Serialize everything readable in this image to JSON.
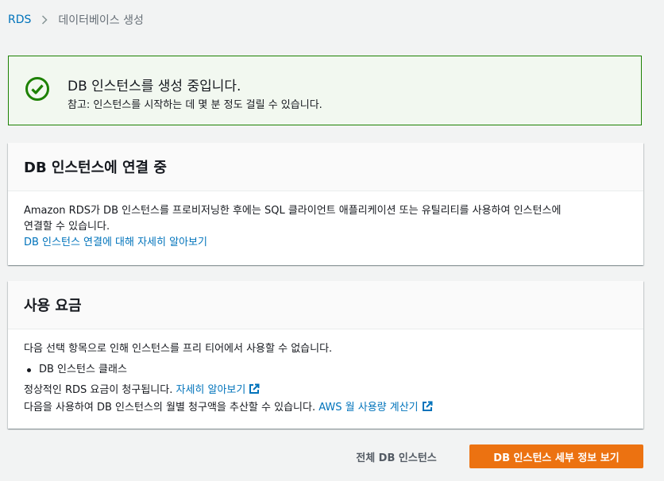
{
  "breadcrumb": {
    "root": "RDS",
    "current": "데이터베이스 생성"
  },
  "flash": {
    "title": "DB 인스턴스를 생성 중입니다.",
    "subtitle": "참고: 인스턴스를 시작하는 데 몇 분 정도 걸릴 수 있습니다.",
    "icon": "check-circle-icon",
    "color": "#1d8102"
  },
  "connect_panel": {
    "title": "DB 인스턴스에 연결 중",
    "body_line1": "Amazon RDS가 DB 인스턴스를 프로비저닝한 후에는 SQL 클라이언트 애플리케이션 또는 유틸리티를 사용하여 인스턴스에",
    "body_line2": "연결할 수 있습니다.",
    "link": "DB 인스턴스 연결에 대해 자세히 알아보기"
  },
  "pricing_panel": {
    "title": "사용 요금",
    "intro": "다음 선택 항목으로 인해 인스턴스를 프리 티어에서 사용할 수 없습니다.",
    "bullets": [
      "DB 인스턴스 클래스"
    ],
    "charge_text": "정상적인 RDS 요금이 청구됩니다.",
    "charge_link": "자세히 알아보기",
    "estimate_text": "다음을 사용하여 DB 인스턴스의 월별 청구액을 추산할 수 있습니다.",
    "estimate_link": "AWS 월 사용량 계산기"
  },
  "actions": {
    "all_instances": "전체 DB 인스턴스",
    "view_details": "DB 인스턴스 세부 정보 보기"
  },
  "colors": {
    "link": "#0073bb",
    "primary": "#ec7211",
    "success": "#1d8102"
  }
}
